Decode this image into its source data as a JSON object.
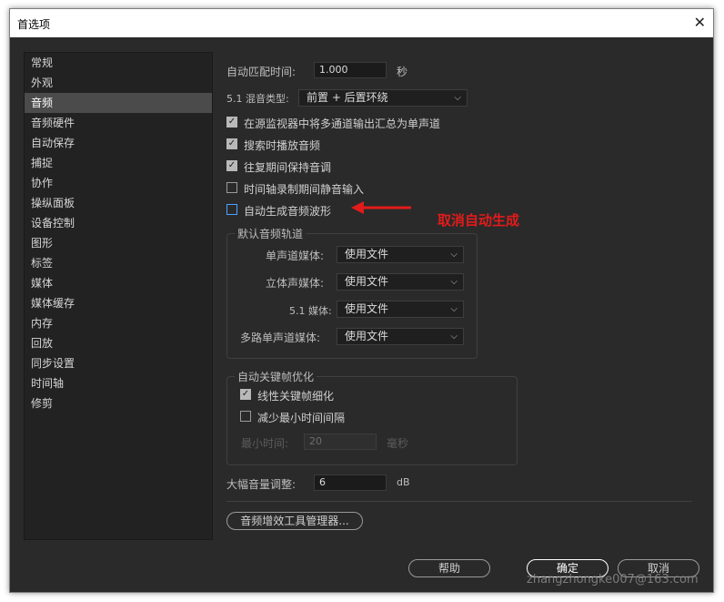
{
  "window": {
    "title": "首选项"
  },
  "sidebar": {
    "items": [
      {
        "label": "常规"
      },
      {
        "label": "外观"
      },
      {
        "label": "音频",
        "selected": true
      },
      {
        "label": "音频硬件"
      },
      {
        "label": "自动保存"
      },
      {
        "label": "捕捉"
      },
      {
        "label": "协作"
      },
      {
        "label": "操纵面板"
      },
      {
        "label": "设备控制"
      },
      {
        "label": "图形"
      },
      {
        "label": "标签"
      },
      {
        "label": "媒体"
      },
      {
        "label": "媒体缓存"
      },
      {
        "label": "内存"
      },
      {
        "label": "回放"
      },
      {
        "label": "同步设置"
      },
      {
        "label": "时间轴"
      },
      {
        "label": "修剪"
      }
    ]
  },
  "audio": {
    "auto_match_label": "自动匹配时间:",
    "auto_match_value": "1.000",
    "auto_match_unit": "秒",
    "mix_type_label": "5.1 混音类型:",
    "mix_type_value": "前置 + 后置环绕",
    "checkboxes": [
      {
        "label": "在源监视器中将多通道输出汇总为单声道",
        "checked": true
      },
      {
        "label": "搜索时播放音频",
        "checked": true
      },
      {
        "label": "往复期间保持音调",
        "checked": true
      },
      {
        "label": "时间轴录制期间静音输入",
        "checked": false
      },
      {
        "label": "自动生成音频波形",
        "checked": false
      }
    ],
    "default_tracks": {
      "legend": "默认音频轨道",
      "rows": [
        {
          "label": "单声道媒体:",
          "value": "使用文件"
        },
        {
          "label": "立体声媒体:",
          "value": "使用文件"
        },
        {
          "label": "5.1 媒体:",
          "value": "使用文件"
        },
        {
          "label": "多路单声道媒体:",
          "value": "使用文件"
        }
      ]
    },
    "keyframe": {
      "legend": "自动关键帧优化",
      "linear_label": "线性关键帧细化",
      "linear_checked": true,
      "reduce_label": "减少最小时间间隔",
      "reduce_checked": false,
      "min_time_label": "最小时间:",
      "min_time_value": "20",
      "min_time_unit": "毫秒"
    },
    "gain_label": "大幅音量调整:",
    "gain_value": "6",
    "gain_unit": "dB",
    "plugin_manager_label": "音频增效工具管理器..."
  },
  "annotation": {
    "text": "取消自动生成",
    "color": "#e21b1b"
  },
  "footer": {
    "help_label": "帮助",
    "ok_label": "确定",
    "cancel_label": "取消"
  },
  "watermark": "zhangzhongke007@163.com",
  "colors": {
    "dialog_bg": "#2a2a2a",
    "selected_item_bg": "#4b4b4b",
    "focus_blue": "#4aa3ff"
  }
}
